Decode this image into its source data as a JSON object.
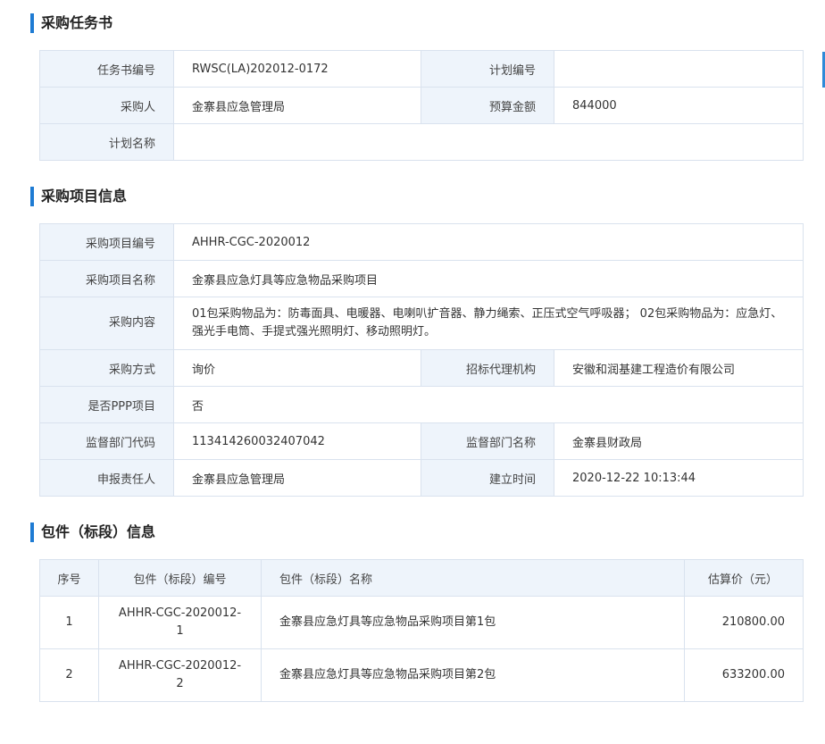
{
  "task": {
    "title": "采购任务书",
    "rows": [
      {
        "l1": "任务书编号",
        "v1": "RWSC(LA)202012-0172",
        "l2": "计划编号",
        "v2": ""
      },
      {
        "l1": "采购人",
        "v1": "金寨县应急管理局",
        "l2": "预算金额",
        "v2": "844000"
      },
      {
        "l1": "计划名称",
        "v1": ""
      }
    ]
  },
  "project": {
    "title": "采购项目信息",
    "code_label": "采购项目编号",
    "code": "AHHR-CGC-2020012",
    "name_label": "采购项目名称",
    "name": "金寨县应急灯具等应急物品采购项目",
    "content_label": "采购内容",
    "content": "01包采购物品为：防毒面具、电暖器、电喇叭扩音器、静力绳索、正压式空气呼吸器； 02包采购物品为：应急灯、强光手电筒、手提式强光照明灯、移动照明灯。",
    "method_label": "采购方式",
    "method": "询价",
    "agency_label": "招标代理机构",
    "agency": "安徽和润基建工程造价有限公司",
    "ppp_label": "是否PPP项目",
    "ppp": "否",
    "sup_code_label": "监督部门代码",
    "sup_code": "113414260032407042",
    "sup_name_label": "监督部门名称",
    "sup_name": "金寨县财政局",
    "resp_label": "申报责任人",
    "resp": "金寨县应急管理局",
    "created_label": "建立时间",
    "created": "2020-12-22 10:13:44"
  },
  "packages": {
    "title": "包件（标段）信息",
    "headers": [
      "序号",
      "包件（标段）编号",
      "包件（标段）名称",
      "估算价（元）"
    ],
    "rows": [
      {
        "no": "1",
        "code": "AHHR-CGC-2020012-1",
        "name": "金寨县应急灯具等应急物品采购项目第1包",
        "price": "210800.00"
      },
      {
        "no": "2",
        "code": "AHHR-CGC-2020012-2",
        "name": "金寨县应急灯具等应急物品采购项目第2包",
        "price": "633200.00"
      }
    ]
  }
}
